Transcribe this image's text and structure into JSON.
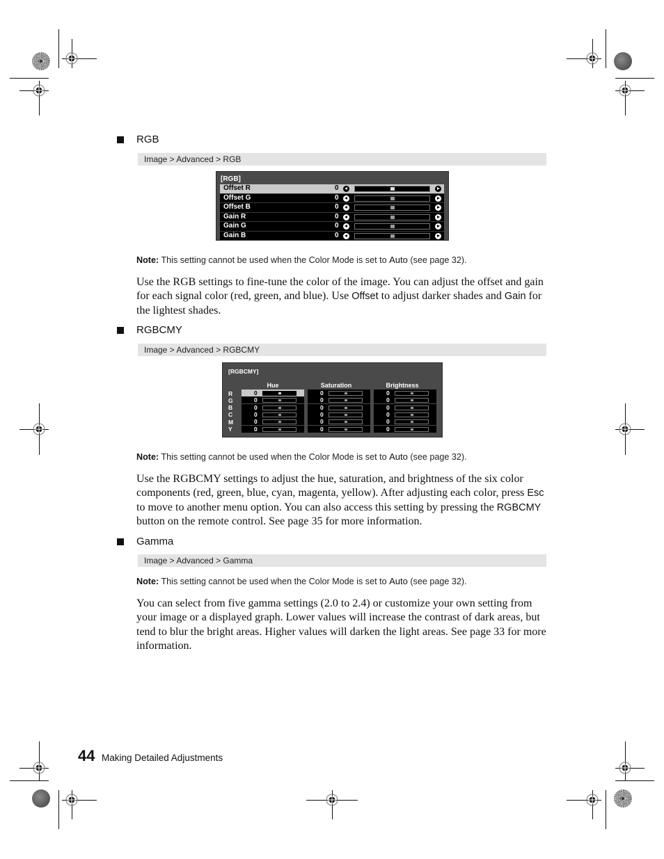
{
  "sections": [
    {
      "heading": "RGB",
      "menu_path": "Image > Advanced > RGB",
      "note": {
        "label": "Note:",
        "text_before": " This setting cannot be used when the Color Mode is set to ",
        "keyword": "Auto",
        "text_after": " (see page 32)."
      },
      "paragraph": {
        "t1": "Use the RGB settings to fine-tune the color of the image. You can adjust the offset and gain for each signal color (red, green, and blue). Use ",
        "k1": "Offset",
        "t2": " to adjust darker shades and ",
        "k2": "Gain",
        "t3": " for the lightest shades."
      }
    },
    {
      "heading": "RGBCMY",
      "menu_path": "Image > Advanced > RGBCMY",
      "note": {
        "label": "Note:",
        "text_before": " This setting cannot be used when the Color Mode is set to ",
        "keyword": "Auto",
        "text_after": " (see page 32)."
      },
      "paragraph": {
        "t1": "Use the RGBCMY settings to adjust the hue, saturation, and brightness of the six color components (red, green, blue, cyan, magenta, yellow). After adjusting each color, press ",
        "k1": "Esc",
        "t2": " to move to another menu option. You can also access this setting by pressing the ",
        "k2": "RGBCMY",
        "t3": " button on the remote control. See page 35 for more information."
      }
    },
    {
      "heading": "Gamma",
      "menu_path": "Image > Advanced > Gamma",
      "note": {
        "label": "Note:",
        "text_before": " This setting cannot be used when the Color Mode is set to ",
        "keyword": "Auto",
        "text_after": " (see page 32)."
      },
      "paragraph": {
        "t1": "You can select from five gamma settings (2.0 to 2.4) or customize your own setting from your image or a displayed graph. Lower values will increase the contrast of dark areas, but tend to blur the bright areas. Higher values will darken the light areas. See page 33 for more information."
      }
    }
  ],
  "rgb_menu": {
    "title": "[RGB]",
    "rows": [
      {
        "label": "Offset R",
        "value": "0",
        "slider_fraction": 0.5,
        "selected": true
      },
      {
        "label": "Offset G",
        "value": "0",
        "slider_fraction": 0.5,
        "selected": false
      },
      {
        "label": "Offset B",
        "value": "0",
        "slider_fraction": 0.5,
        "selected": false
      },
      {
        "label": "Gain R",
        "value": "0",
        "slider_fraction": 0.5,
        "selected": false
      },
      {
        "label": "Gain G",
        "value": "0",
        "slider_fraction": 0.5,
        "selected": false
      },
      {
        "label": "Gain B",
        "value": "0",
        "slider_fraction": 0.5,
        "selected": false
      }
    ]
  },
  "rgbcmy_menu": {
    "title": "[RGBCMY]",
    "columns": [
      "Hue",
      "Saturation",
      "Brightness"
    ],
    "rows": [
      {
        "letter": "R",
        "values": [
          "0",
          "0",
          "0"
        ]
      },
      {
        "letter": "G",
        "values": [
          "0",
          "0",
          "0"
        ]
      },
      {
        "letter": "B",
        "values": [
          "0",
          "0",
          "0"
        ]
      },
      {
        "letter": "C",
        "values": [
          "0",
          "0",
          "0"
        ]
      },
      {
        "letter": "M",
        "values": [
          "0",
          "0",
          "0"
        ]
      },
      {
        "letter": "Y",
        "values": [
          "0",
          "0",
          "0"
        ]
      }
    ],
    "slider_fraction": 0.5,
    "selected_cell": {
      "row": 0,
      "col": 0
    }
  },
  "footer": {
    "page_number": "44",
    "chapter_title": "Making Detailed Adjustments"
  }
}
